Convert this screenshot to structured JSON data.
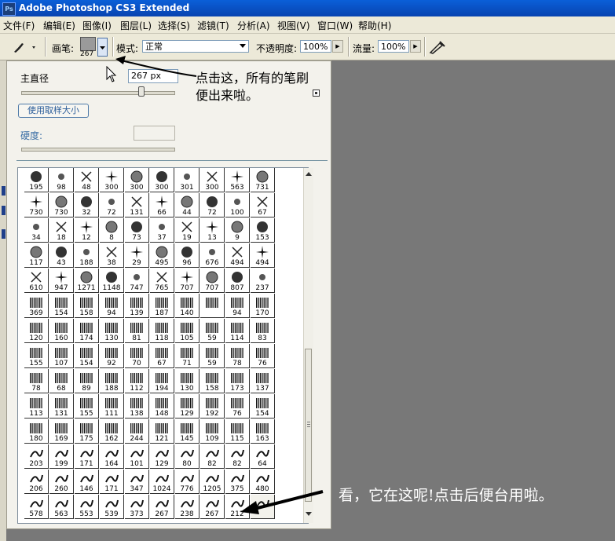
{
  "window": {
    "title": "Adobe Photoshop CS3 Extended",
    "logo": "Ps"
  },
  "menu": [
    "文件(F)",
    "编辑(E)",
    "图像(I)",
    "图层(L)",
    "选择(S)",
    "滤镜(T)",
    "分析(A)",
    "视图(V)",
    "窗口(W)",
    "帮助(H)"
  ],
  "options": {
    "brush_label": "画笔:",
    "brush_size": "267",
    "mode_label": "模式:",
    "mode_value": "正常",
    "opacity_label": "不透明度:",
    "opacity_value": "100%",
    "flow_label": "流量:",
    "flow_value": "100%"
  },
  "panel": {
    "master_diameter_label": "主直径",
    "diameter_value": "267 px",
    "use_sample_size": "使用取样大小",
    "hardness_label": "硬度:"
  },
  "brush_presets": [
    "195",
    "98",
    "48",
    "300",
    "300",
    "300",
    "301",
    "300",
    "563",
    "731",
    "730",
    "730",
    "32",
    "72",
    "131",
    "66",
    "44",
    "72",
    "100",
    "67",
    "34",
    "18",
    "12",
    "8",
    "73",
    "37",
    "19",
    "13",
    "9",
    "153",
    "117",
    "43",
    "188",
    "38",
    "29",
    "495",
    "96",
    "676",
    "494",
    "494",
    "610",
    "947",
    "1271",
    "1148",
    "747",
    "765",
    "707",
    "707",
    "807",
    "237",
    "369",
    "154",
    "158",
    "94",
    "139",
    "187",
    "140",
    "",
    "94",
    "170",
    "120",
    "160",
    "174",
    "130",
    "81",
    "118",
    "105",
    "59",
    "114",
    "83",
    "155",
    "107",
    "154",
    "92",
    "70",
    "67",
    "71",
    "59",
    "78",
    "76",
    "78",
    "68",
    "89",
    "188",
    "112",
    "194",
    "130",
    "158",
    "173",
    "137",
    "113",
    "131",
    "155",
    "111",
    "138",
    "148",
    "129",
    "192",
    "76",
    "154",
    "180",
    "169",
    "175",
    "162",
    "244",
    "121",
    "145",
    "109",
    "115",
    "163",
    "203",
    "199",
    "171",
    "164",
    "101",
    "129",
    "80",
    "82",
    "82",
    "64",
    "206",
    "260",
    "146",
    "171",
    "347",
    "1024",
    "776",
    "1205",
    "375",
    "480",
    "578",
    "563",
    "553",
    "539",
    "373",
    "267",
    "238",
    "267",
    "212",
    ""
  ],
  "annotations": {
    "top_line1": "点击这，所有的笔刷",
    "top_line2": "便出来啦。",
    "bottom": "看，它在这呢!点击后便台用啦。"
  },
  "colors": {
    "title_bar": "#0a54c8",
    "canvas": "#787878",
    "panel": "#f3f2ec"
  }
}
